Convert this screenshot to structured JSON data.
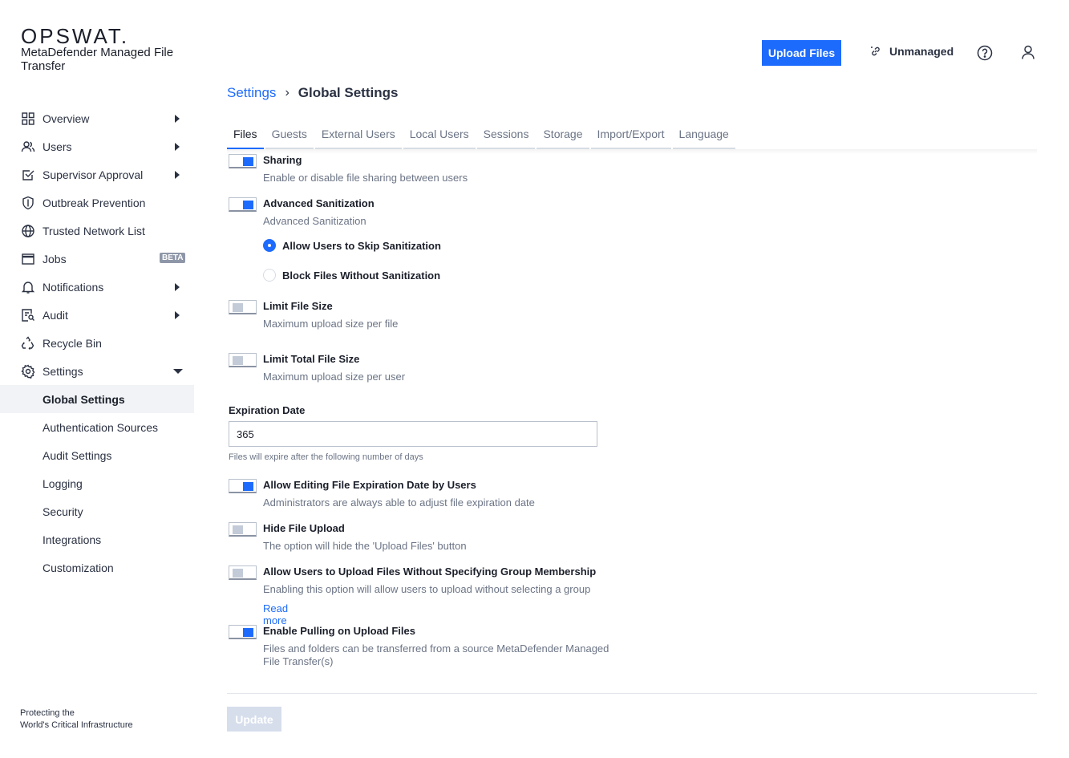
{
  "brand": {
    "logo": "OPSWAT.",
    "product": "MetaDefender Managed File Transfer",
    "footer_line1": "Protecting the",
    "footer_line2": "World's Critical Infrastructure"
  },
  "header": {
    "upload_label": "Upload Files",
    "unmanaged_label": "Unmanaged"
  },
  "sidebar": {
    "items": [
      {
        "label": "Overview"
      },
      {
        "label": "Users"
      },
      {
        "label": "Supervisor Approval"
      },
      {
        "label": "Outbreak Prevention"
      },
      {
        "label": "Trusted Network List"
      },
      {
        "label": "Jobs",
        "badge": "BETA"
      },
      {
        "label": "Notifications"
      },
      {
        "label": "Audit"
      },
      {
        "label": "Recycle Bin"
      },
      {
        "label": "Settings"
      }
    ],
    "sub_items": [
      {
        "label": "Global Settings"
      },
      {
        "label": "Authentication Sources"
      },
      {
        "label": "Audit Settings"
      },
      {
        "label": "Logging"
      },
      {
        "label": "Security"
      },
      {
        "label": "Integrations"
      },
      {
        "label": "Customization"
      }
    ]
  },
  "breadcrumb": {
    "parent": "Settings",
    "current": "Global Settings"
  },
  "tabs": [
    {
      "label": "Files"
    },
    {
      "label": "Guests"
    },
    {
      "label": "External Users"
    },
    {
      "label": "Local Users"
    },
    {
      "label": "Sessions"
    },
    {
      "label": "Storage"
    },
    {
      "label": "Import/Export"
    },
    {
      "label": "Language"
    }
  ],
  "settings": {
    "sharing": {
      "title": "Sharing",
      "desc": "Enable or disable file sharing between users",
      "enabled": true
    },
    "advanced": {
      "title": "Advanced Sanitization",
      "desc": "Advanced Sanitization",
      "enabled": true
    },
    "radio_skip": "Allow Users to Skip Sanitization",
    "radio_block": "Block Files Without Sanitization",
    "limit_size": {
      "title": "Limit File Size",
      "desc": "Maximum upload size per file",
      "enabled": false
    },
    "limit_total": {
      "title": "Limit Total File Size",
      "desc": "Maximum upload size per user",
      "enabled": false
    },
    "expiration": {
      "label": "Expiration Date",
      "value": "365",
      "help": "Files will expire after the following number of days"
    },
    "allow_edit": {
      "title": "Allow Editing File Expiration Date by Users",
      "desc": "Administrators are always able to adjust file expiration date",
      "enabled": true
    },
    "hide_upload": {
      "title": "Hide File Upload",
      "desc": "The option will hide the 'Upload Files' button",
      "enabled": false
    },
    "no_group": {
      "title": "Allow Users to Upload Files Without Specifying Group Membership",
      "desc": "Enabling this option will allow users to upload without selecting a group",
      "link": "Read more",
      "enabled": false
    },
    "pulling": {
      "title": "Enable Pulling on Upload Files",
      "desc_line1": "Files and folders can be transferred from a source MetaDefender Managed",
      "desc_line2": "File Transfer(s)",
      "enabled": true
    }
  },
  "update_label": "Update",
  "colors": {
    "accent": "#1d6bfc",
    "disabled": "#d6deec"
  }
}
